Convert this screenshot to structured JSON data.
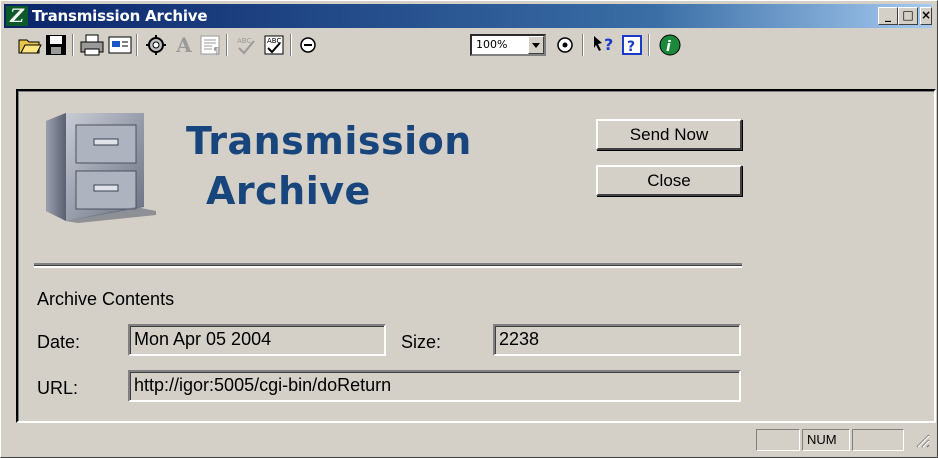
{
  "window": {
    "title": "Transmission Archive",
    "controls": {
      "minimize": "_",
      "maximize": "□",
      "close": "×"
    }
  },
  "toolbar": {
    "zoom_value": "100%",
    "tools": [
      "open-folder-icon",
      "save-disk-icon",
      "print-icon",
      "preview-icon",
      "settings-icon",
      "font-icon",
      "format-icon",
      "spellcheck-icon",
      "spellcheck-doc-icon",
      "zoom-out-icon",
      "zoom-in-icon",
      "context-help-icon",
      "help-icon",
      "info-icon"
    ]
  },
  "header": {
    "title_line1": "Transmission",
    "title_line2": "Archive"
  },
  "actions": {
    "send_now": "Send Now",
    "close": "Close"
  },
  "archive": {
    "section_label": "Archive Contents",
    "date_label": "Date:",
    "date_value": "Mon Apr 05 2004",
    "size_label": "Size:",
    "size_value": "2238",
    "url_label": "URL:",
    "url_value": "http://igor:5005/cgi-bin/doReturn"
  },
  "statusbar": {
    "num": "NUM"
  },
  "colors": {
    "title_blue": "#17457c",
    "titlebar_start": "#0a246a",
    "window_gray": "#d4d0c8"
  }
}
